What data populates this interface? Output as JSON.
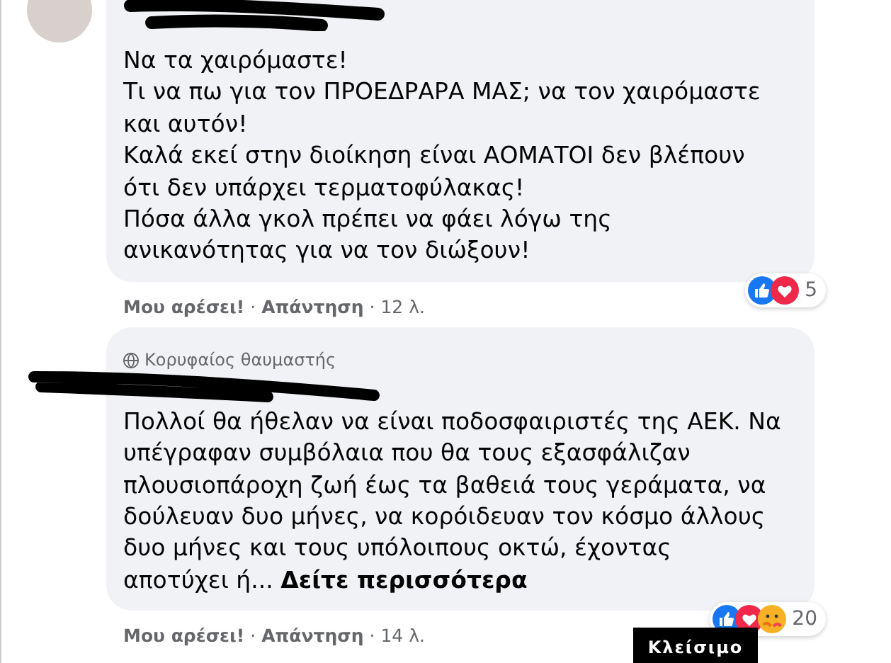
{
  "comments": [
    {
      "avatar": true,
      "lines": [
        "Να τα χαιρόμαστε!",
        "Τι να πω για τον ΠΡΟΕΔΡΑΡΑ ΜΑΣ; να τον χαιρόμαστε",
        "και αυτόν!",
        "Καλά εκεί στην διοίκηση είναι ΑΟΜΑΤΟΙ δεν βλέπουν",
        "ότι δεν υπάρχει τερματοφύλακας!",
        "Πόσα άλλα γκολ πρέπει να φάει λόγω της",
        "ανικανότητας για να τον διώξουν!"
      ],
      "actions": [
        "Μου αρέσει!",
        "·",
        "Απάντηση",
        "·"
      ],
      "time": "12 λ.",
      "reactions": [
        {
          "kind": "like"
        },
        {
          "kind": "love"
        }
      ],
      "reaction_count": "5"
    },
    {
      "avatar": false,
      "badge": "Κορυφαίος θαυμαστής",
      "lines": [
        "Πολλοί θα ήθελαν να είναι ποδοσφαιριστές της ΑΕΚ. Να",
        "υπέγραφαν συμβόλαια που θα τους εξασφάλιζαν",
        "πλουσιοπάροχη ζωή έως τα βαθειά τους γεράματα, να",
        "δούλευαν δυο μήνες, να κορόιδευαν τον κόσμο άλλους",
        "δυο μήνες και τους υπόλοιπους οκτώ, έχοντας",
        "αποτύχει ή..."
      ],
      "see_more": "Δείτε περισσότερα",
      "actions": [
        "Μου αρέσει!",
        "·",
        "Απάντηση",
        "·"
      ],
      "time": "14 λ.",
      "reactions": [
        {
          "kind": "like"
        },
        {
          "kind": "love"
        },
        {
          "kind": "care"
        }
      ],
      "reaction_count": "20"
    }
  ],
  "tooltip": "Κλείσιμο"
}
